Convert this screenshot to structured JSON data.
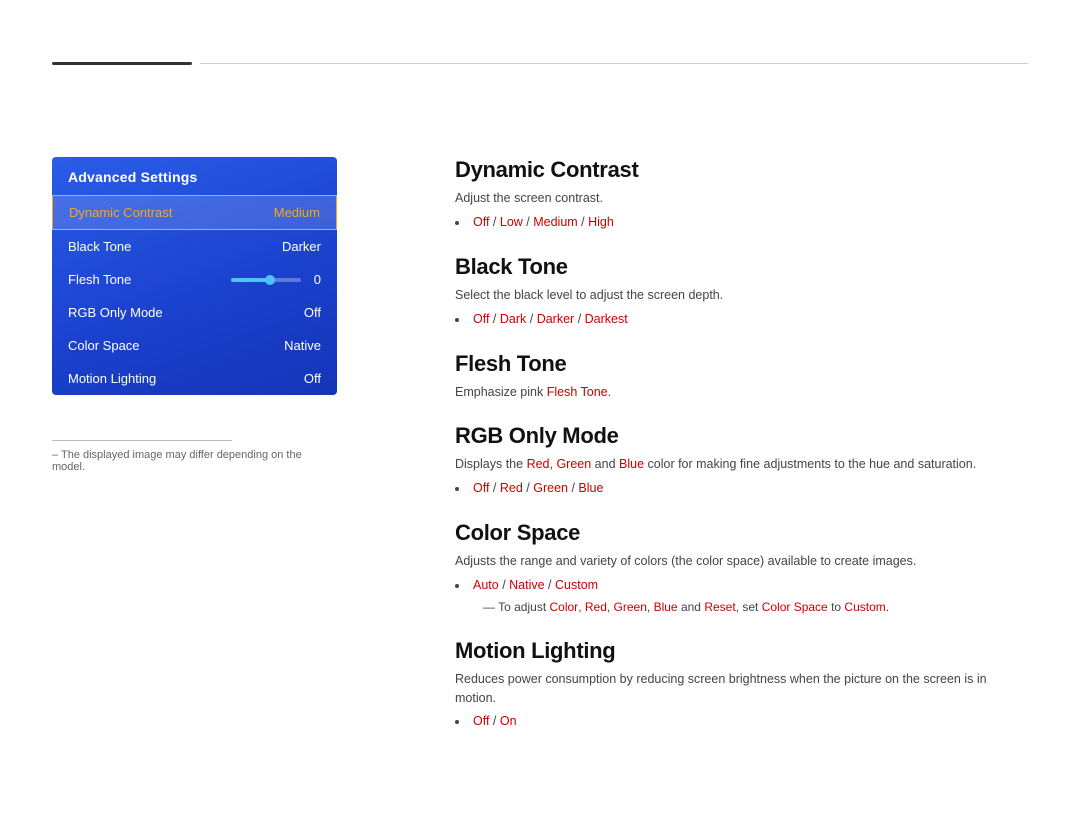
{
  "top": {
    "note": "The displayed image may differ depending on the model."
  },
  "panel": {
    "title": "Advanced Settings",
    "items": [
      {
        "label": "Dynamic Contrast",
        "value": "Medium",
        "active": true
      },
      {
        "label": "Black Tone",
        "value": "Darker",
        "active": false
      },
      {
        "label": "RGB Only Mode",
        "value": "Off",
        "active": false
      },
      {
        "label": "Color Space",
        "value": "Native",
        "active": false
      },
      {
        "label": "Motion Lighting",
        "value": "Off",
        "active": false
      }
    ],
    "flesh_tone": {
      "label": "Flesh Tone",
      "value": "0"
    }
  },
  "sections": [
    {
      "id": "dynamic-contrast",
      "title": "Dynamic Contrast",
      "desc": "Adjust the screen contrast.",
      "options_prefix": "",
      "options": "Off / Low / Medium / High",
      "sub_note": null
    },
    {
      "id": "black-tone",
      "title": "Black Tone",
      "desc": "Select the black level to adjust the screen depth.",
      "options": "Off / Dark / Darker / Darkest",
      "sub_note": null
    },
    {
      "id": "flesh-tone",
      "title": "Flesh Tone",
      "desc": "Emphasize pink Flesh Tone.",
      "options": null,
      "sub_note": null
    },
    {
      "id": "rgb-only-mode",
      "title": "RGB Only Mode",
      "desc": "Displays the Red, Green and Blue color for making fine adjustments to the hue and saturation.",
      "options": "Off / Red / Green / Blue",
      "sub_note": null
    },
    {
      "id": "color-space",
      "title": "Color Space",
      "desc": "Adjusts the range and variety of colors (the color space) available to create images.",
      "options": "Auto / Native / Custom",
      "sub_note": "To adjust Color, Red, Green, Blue and Reset, set Color Space to Custom."
    },
    {
      "id": "motion-lighting",
      "title": "Motion Lighting",
      "desc": "Reduces power consumption by reducing screen brightness when the picture on the screen is in motion.",
      "options": "Off / On",
      "sub_note": null
    }
  ]
}
